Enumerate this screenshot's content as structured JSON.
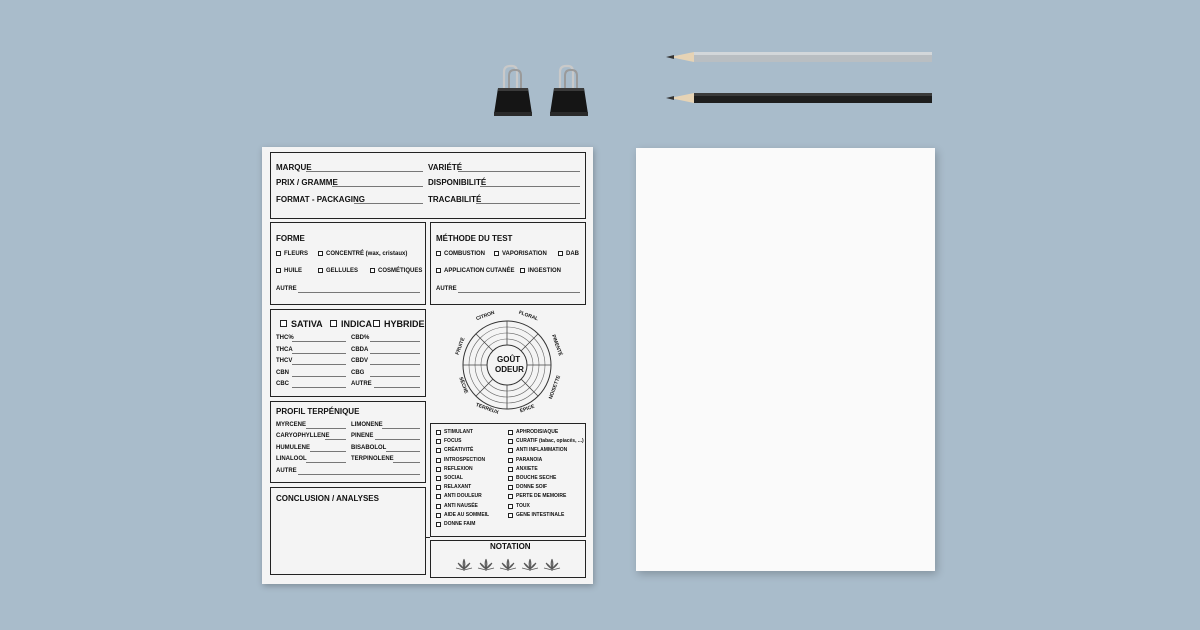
{
  "header": {
    "marque": "MARQUE",
    "variete": "VARIÉTÉ",
    "prix": "PRIX / GRAMME",
    "disponibilite": "DISPONIBILITÉ",
    "format": "FORMAT - PACKAGING",
    "tracabilite": "TRACABILITÉ"
  },
  "forme": {
    "title": "FORME",
    "fleurs": "FLEURS",
    "concentre": "CONCENTRÉ (wax, cristaux)",
    "huile": "HUILE",
    "gellules": "GELLULES",
    "cosmetiques": "COSMÉTIQUES",
    "autre": "AUTRE"
  },
  "methode": {
    "title": "MÉTHODE DU TEST",
    "combustion": "COMBUSTION",
    "vaporisation": "VAPORISATION",
    "dab": "DAB",
    "application": "APPLICATION CUTANÉE",
    "ingestion": "INGESTION",
    "autre": "AUTRE"
  },
  "type": {
    "sativa": "SATIVA",
    "indica": "INDICA",
    "hybride": "HYBRIDE",
    "left": [
      "THC%",
      "THCA",
      "THCV",
      "CBN",
      "CBC"
    ],
    "right": [
      "CBD%",
      "CBDA",
      "CBDV",
      "CBG",
      "AUTRE"
    ]
  },
  "wheel": {
    "center1": "GOÛT",
    "center2": "ODEUR",
    "labels": [
      "CITRON",
      "FLORAL",
      "PIMENTÉ",
      "NOISETTE",
      "ÉPICE",
      "TERREUX",
      "SÈCHE",
      "FRUITÉ"
    ]
  },
  "terpenes": {
    "title": "PROFIL TERPÉNIQUE",
    "left": [
      "MYRCENE",
      "CARYOPHYLLENE",
      "HUMULENE",
      "LINALOOL",
      "AUTRE"
    ],
    "right": [
      "LIMONENE",
      "PINENE",
      "BISABOLOL",
      "TERPINOLENE"
    ]
  },
  "effects": {
    "left": [
      "STIMULANT",
      "FOCUS",
      "CRÉATIVITÉ",
      "INTROSPECTION",
      "REFLEXION",
      "SOCIAL",
      "RELAXANT",
      "ANTI DOULEUR",
      "ANTI NAUSÉE",
      "AIDE AU SOMMEIL",
      "DONNE FAIM"
    ],
    "right": [
      "APHRODISIAQUE",
      "CURATIF (tabac, opiacés, ...)",
      "ANTI INFLAMMATION",
      "PARANOIA",
      "ANXIETE",
      "BOUCHE SECHE",
      "DONNE SOIF",
      "PERTE DE MEMOIRE",
      "TOUX",
      "GENE INTESTINALE"
    ]
  },
  "conclusion": {
    "title": "CONCLUSION / ANALYSES"
  },
  "notation": {
    "title": "NOTATION",
    "stars": 5
  },
  "colors": {
    "background": "#a9bccb",
    "sheet": "#f4f4f4",
    "ink": "#111111"
  }
}
